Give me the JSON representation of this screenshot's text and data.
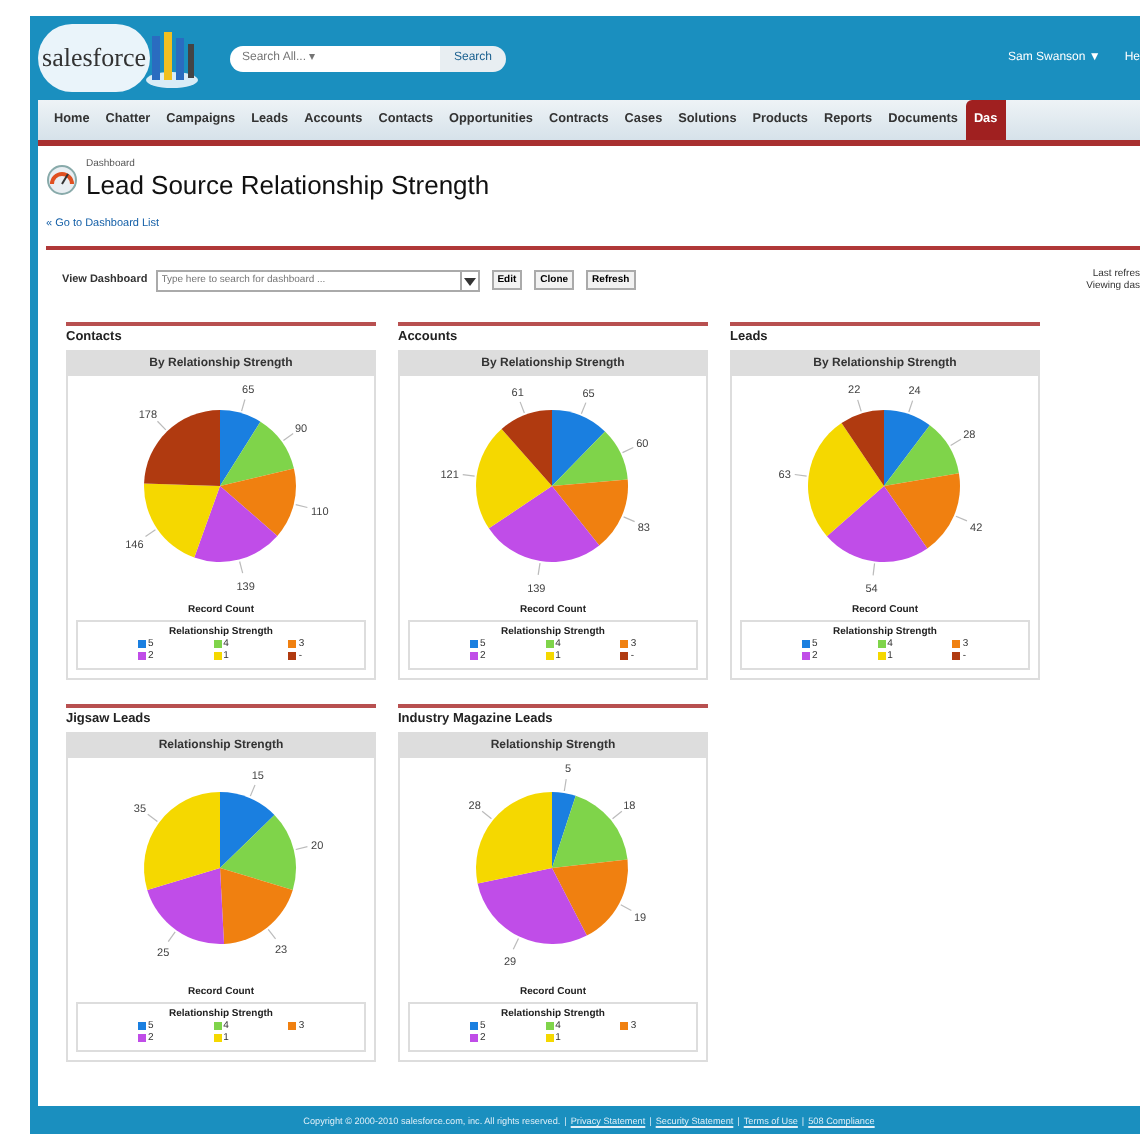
{
  "header": {
    "logo": "salesforce",
    "search": {
      "placeholder": "Search All... ▾"
    },
    "search_button": "Search",
    "user": "Sam Swanson ▼",
    "help": "He"
  },
  "tabs": [
    {
      "label": "Home",
      "selected": false
    },
    {
      "label": "Chatter",
      "selected": false
    },
    {
      "label": "Campaigns",
      "selected": false
    },
    {
      "label": "Leads",
      "selected": false
    },
    {
      "label": "Accounts",
      "selected": false
    },
    {
      "label": "Contacts",
      "selected": false
    },
    {
      "label": "Opportunities",
      "selected": false
    },
    {
      "label": "Contracts",
      "selected": false
    },
    {
      "label": "Cases",
      "selected": false
    },
    {
      "label": "Solutions",
      "selected": false
    },
    {
      "label": "Products",
      "selected": false
    },
    {
      "label": "Reports",
      "selected": false
    },
    {
      "label": "Documents",
      "selected": false
    },
    {
      "label": "Das",
      "selected": true
    }
  ],
  "breadcrumb": "Dashboard",
  "title": "Lead Source Relationship Strength",
  "back_link": "« Go to Dashboard List",
  "toolbar": {
    "label": "View Dashboard",
    "search": {
      "placeholder": "Type here to search for dashboard ..."
    },
    "buttons": [
      "Edit",
      "Clone",
      "Refresh"
    ]
  },
  "refresh_info": [
    "Last refres",
    "Viewing das"
  ],
  "components": [
    {
      "title": "Contacts",
      "chart_data": {
        "type": "pie",
        "title": "By Relationship Strength",
        "xlabel": "Record Count",
        "categories": [
          "5",
          "4",
          "3",
          "2",
          "1",
          "-"
        ],
        "series": [
          {
            "name": "Relationship Strength",
            "values": [
              65,
              90,
              110,
              139,
              146,
              178
            ]
          }
        ],
        "data_labels": true
      },
      "legend": {
        "items": [
          {
            "color": "#1a7fe0"
          },
          {
            "color": "#7fd44a"
          },
          {
            "color": "#f08010"
          },
          {
            "color": "#c04de8"
          },
          {
            "color": "#f5d800"
          },
          {
            "color": "#b03a10"
          }
        ]
      }
    },
    {
      "title": "Accounts",
      "chart_data": {
        "type": "pie",
        "title": "By Relationship Strength",
        "xlabel": "Record Count",
        "categories": [
          "5",
          "4",
          "3",
          "2",
          "1",
          "-"
        ],
        "series": [
          {
            "name": "Relationship Strength",
            "values": [
              65,
              60,
              83,
              139,
              121,
              61
            ]
          }
        ],
        "data_labels": true
      },
      "legend": {
        "items": [
          {
            "color": "#1a7fe0"
          },
          {
            "color": "#7fd44a"
          },
          {
            "color": "#f08010"
          },
          {
            "color": "#c04de8"
          },
          {
            "color": "#f5d800"
          },
          {
            "color": "#b03a10"
          }
        ]
      }
    },
    {
      "title": "Leads",
      "chart_data": {
        "type": "pie",
        "title": "By Relationship Strength",
        "xlabel": "Record Count",
        "categories": [
          "5",
          "4",
          "3",
          "2",
          "1",
          "-"
        ],
        "series": [
          {
            "name": "Relationship Strength",
            "values": [
              24,
              28,
              42,
              54,
              63,
              22
            ]
          }
        ],
        "data_labels": true
      },
      "legend": {
        "items": [
          {
            "color": "#1a7fe0"
          },
          {
            "color": "#7fd44a"
          },
          {
            "color": "#f08010"
          },
          {
            "color": "#c04de8"
          },
          {
            "color": "#f5d800"
          },
          {
            "color": "#b03a10"
          }
        ]
      }
    },
    {
      "title": "Jigsaw Leads",
      "chart_data": {
        "type": "pie",
        "title": "Relationship Strength",
        "xlabel": "Record Count",
        "categories": [
          "5",
          "4",
          "3",
          "2",
          "1"
        ],
        "series": [
          {
            "name": "Relationship Strength",
            "values": [
              15,
              20,
              23,
              25,
              35
            ]
          }
        ],
        "data_labels": true
      },
      "legend": {
        "items": [
          {
            "color": "#1a7fe0"
          },
          {
            "color": "#7fd44a"
          },
          {
            "color": "#f08010"
          },
          {
            "color": "#c04de8"
          },
          {
            "color": "#f5d800"
          }
        ]
      }
    },
    {
      "title": "Industry Magazine Leads",
      "chart_data": {
        "type": "pie",
        "title": "Relationship Strength",
        "xlabel": "Record Count",
        "categories": [
          "5",
          "4",
          "3",
          "2",
          "1"
        ],
        "series": [
          {
            "name": "Relationship Strength",
            "values": [
              5,
              18,
              19,
              29,
              28
            ]
          }
        ],
        "data_labels": true
      },
      "legend": {
        "items": [
          {
            "color": "#1a7fe0"
          },
          {
            "color": "#7fd44a"
          },
          {
            "color": "#f08010"
          },
          {
            "color": "#c04de8"
          },
          {
            "color": "#f5d800"
          }
        ]
      }
    }
  ],
  "footer": {
    "separators": [
      "|",
      "|",
      "|",
      "|"
    ],
    "copyright": "Copyright © 2000-2010 salesforce.com, inc. All rights reserved.",
    "links": [
      "Privacy Statement",
      "Security Statement",
      "Terms of Use",
      "508 Compliance"
    ]
  }
}
